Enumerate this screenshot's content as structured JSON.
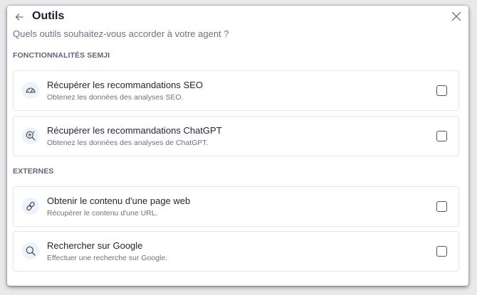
{
  "dialog": {
    "title": "Outils",
    "subtitle": "Quels outils souhaitez-vous accorder à votre agent ?",
    "back_icon": "arrow-left-icon",
    "close_icon": "close-icon"
  },
  "sections": [
    {
      "label": "FONCTIONNALITÉS SEMJI",
      "items": [
        {
          "title": "Récupérer les recommandations SEO",
          "description": "Obtenez les données des analyses SEO.",
          "icon": "gauge-icon",
          "checked": false
        },
        {
          "title": "Récupérer les recommandations ChatGPT",
          "description": "Obtenez les données des analyses de ChatGPT.",
          "icon": "search-sparkle-icon",
          "checked": false
        }
      ]
    },
    {
      "label": "EXTERNES",
      "items": [
        {
          "title": "Obtenir le contenu d'une page web",
          "description": "Récupérer le contenu d'une URL.",
          "icon": "link-icon",
          "checked": false
        },
        {
          "title": "Rechercher sur Google",
          "description": "Effectuer une recherche sur Google.",
          "icon": "search-icon",
          "checked": false
        }
      ]
    }
  ],
  "colors": {
    "icon_stroke": "#3d4350",
    "icon_bg": "#eef3fa",
    "card_border": "#e4e6ea",
    "section_label": "#5f6673"
  }
}
